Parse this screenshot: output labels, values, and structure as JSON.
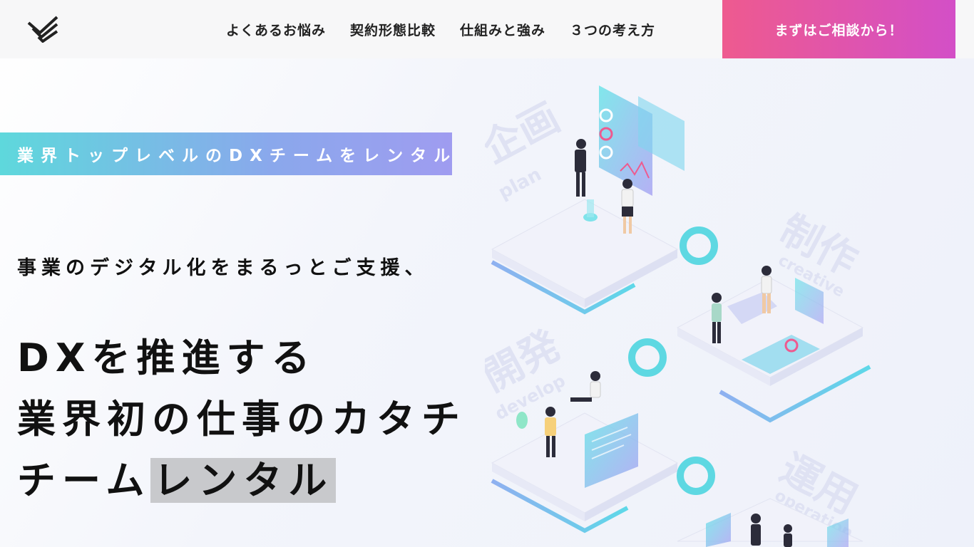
{
  "header": {
    "nav": [
      "よくあるお悩み",
      "契約形態比較",
      "仕組みと強み",
      "３つの考え方"
    ],
    "cta_label": "まずはご相談から！"
  },
  "hero": {
    "tagline": "業界トップレベルのDXチームをレンタル",
    "subhead": "事業のデジタル化をまるっとご支援、",
    "headline_line1": "DXを推進する",
    "headline_line2": "業界初の仕事のカタチ",
    "headline_line3_prefix": "チーム",
    "headline_line3_highlight": "レンタル"
  },
  "illustration": {
    "labels": [
      {
        "jp": "企画",
        "en": "plan"
      },
      {
        "jp": "制作",
        "en": "creative"
      },
      {
        "jp": "開発",
        "en": "develop"
      },
      {
        "jp": "運用",
        "en": "operation"
      }
    ]
  },
  "colors": {
    "accent_pink": "#ee5a8f",
    "accent_purple": "#d34fc7",
    "accent_cyan": "#5ed8dc",
    "accent_blue": "#9f9cf0"
  }
}
